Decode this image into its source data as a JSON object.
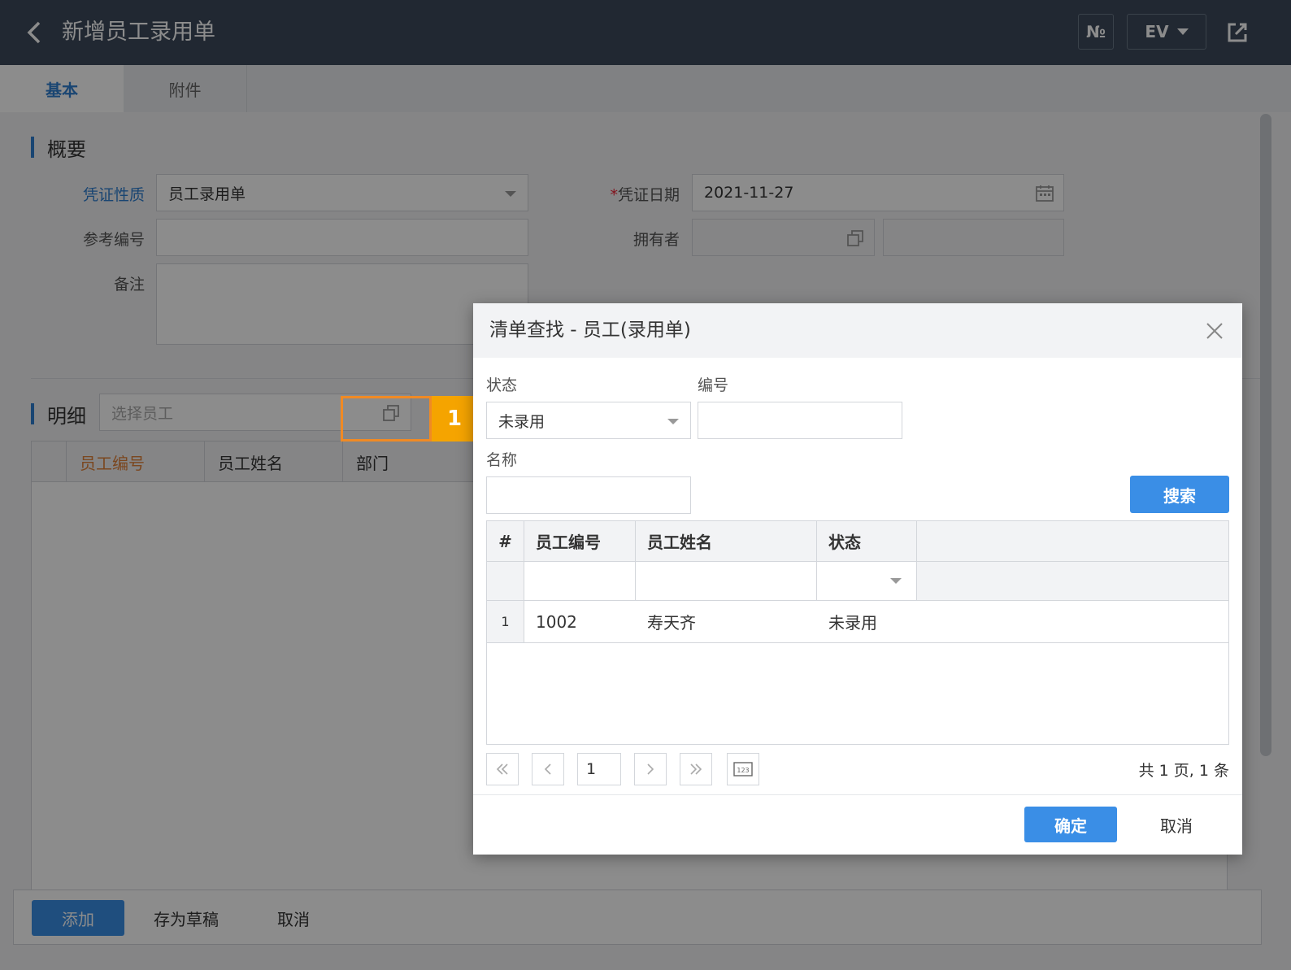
{
  "header": {
    "title": "新增员工录用单",
    "no_label": "№",
    "lang_label": "EV"
  },
  "tabs": [
    {
      "label": "基本"
    },
    {
      "label": "附件"
    }
  ],
  "summary": {
    "section_title": "概要",
    "voucher_type_label": "凭证性质",
    "voucher_type_value": "员工录用单",
    "voucher_date_required": "*",
    "voucher_date_label": "凭证日期",
    "voucher_date_value": "2021-11-27",
    "ref_no_label": "参考编号",
    "owner_label": "拥有者",
    "remark_label": "备注"
  },
  "detail": {
    "section_title": "明细",
    "employee_placeholder": "选择员工",
    "columns": [
      "员工编号",
      "员工姓名",
      "部门"
    ],
    "callout_number": "1"
  },
  "footer": {
    "add_label": "添加",
    "draft_label": "存为草稿",
    "cancel_label": "取消"
  },
  "dialog": {
    "title": "清单查找 - 员工(录用单)",
    "status_label": "状态",
    "status_value": "未录用",
    "code_label": "编号",
    "name_label": "名称",
    "search_label": "搜索",
    "columns": [
      "#",
      "员工编号",
      "员工姓名",
      "状态"
    ],
    "rows": [
      {
        "index": "1",
        "code": "1002",
        "name": "寿天齐",
        "status": "未录用"
      }
    ],
    "pager": {
      "page_value": "1",
      "total_text": "共 1 页, 1 条"
    },
    "ok_label": "确定",
    "cancel_label": "取消"
  },
  "colors": {
    "header_bg": "#3c4a5c",
    "accent": "#3a8ee6",
    "highlight": "#f08a24",
    "badge": "#f5a400"
  }
}
